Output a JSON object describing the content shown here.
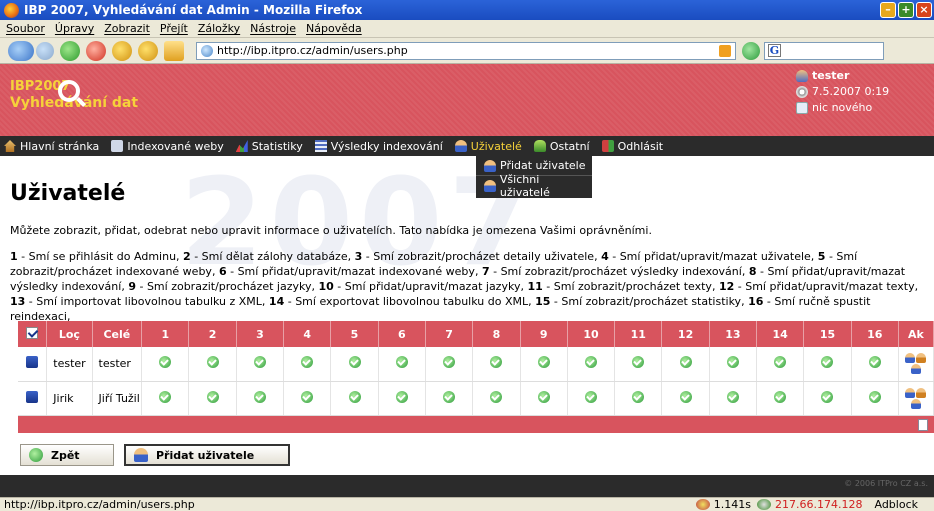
{
  "window": {
    "title": "IBP 2007, Vyhledávání dat Admin - Mozilla Firefox"
  },
  "menu": [
    "Soubor",
    "Úpravy",
    "Zobrazit",
    "Přejít",
    "Záložky",
    "Nástroje",
    "Nápověda"
  ],
  "address_bar": {
    "url": "http://ibp.itpro.cz/admin/users.php",
    "search_value": ""
  },
  "site": {
    "logo_line1": "IBP2007",
    "logo_line2": "Vyhledávání dat",
    "user": {
      "name": "tester",
      "datetime": "7.5.2007 0:19",
      "news": "nic nového"
    }
  },
  "nav": {
    "items": [
      {
        "label": "Hlavní stránka",
        "icon": "home-icon"
      },
      {
        "label": "Indexované weby",
        "icon": "web-icon"
      },
      {
        "label": "Statistiky",
        "icon": "stats-icon"
      },
      {
        "label": "Výsledky indexování",
        "icon": "results-icon"
      },
      {
        "label": "Uživatelé",
        "icon": "users-icon"
      },
      {
        "label": "Ostatní",
        "icon": "other-icon"
      },
      {
        "label": "Odhlásit",
        "icon": "logout-icon"
      }
    ],
    "dropdown": [
      "Přidat uživatele",
      "Všichni uživatelé"
    ]
  },
  "page": {
    "title": "Uživatelé",
    "intro": "Můžete zobrazit, přidat, odebrat nebo upravit informace o uživatelích. Tato nabídka je omezena Vašimi oprávněními.",
    "permissions": [
      {
        "num": "1",
        "text": "Smí se přihlásit do Adminu"
      },
      {
        "num": "2",
        "text": "Smí dělat zálohy databáze"
      },
      {
        "num": "3",
        "text": "Smí zobrazit/procházet detaily uživatele"
      },
      {
        "num": "4",
        "text": "Smí přidat/upravit/mazat uživatele"
      },
      {
        "num": "5",
        "text": "Smí zobrazit/procházet indexované weby"
      },
      {
        "num": "6",
        "text": "Smí přidat/upravit/mazat indexované weby"
      },
      {
        "num": "7",
        "text": "Smí zobrazit/procházet výsledky indexování"
      },
      {
        "num": "8",
        "text": "Smí přidat/upravit/mazat výsledky indexování"
      },
      {
        "num": "9",
        "text": "Smí zobrazit/procházet jazyky"
      },
      {
        "num": "10",
        "text": "Smí přidat/upravit/mazat jazyky"
      },
      {
        "num": "11",
        "text": "Smí zobrazit/procházet texty"
      },
      {
        "num": "12",
        "text": "Smí přidat/upravit/mazat texty"
      },
      {
        "num": "13",
        "text": "Smí importovat libovolnou tabulku z XML"
      },
      {
        "num": "14",
        "text": "Smí exportovat libovolnou tabulku do XML"
      },
      {
        "num": "15",
        "text": "Smí zobrazit/procházet statistiky"
      },
      {
        "num": "16",
        "text": "Smí ručně spustit reindexaci"
      }
    ]
  },
  "table": {
    "headers": [
      "",
      "Loç",
      "Celé",
      "1",
      "2",
      "3",
      "4",
      "5",
      "6",
      "7",
      "8",
      "9",
      "10",
      "11",
      "12",
      "13",
      "14",
      "15",
      "16",
      "Ak"
    ],
    "rows": [
      {
        "login": "tester",
        "name": "tester",
        "perms": [
          true,
          true,
          true,
          true,
          true,
          true,
          true,
          true,
          true,
          true,
          true,
          true,
          true,
          true,
          true,
          true
        ]
      },
      {
        "login": "Jirik",
        "name": "Jiří Tužil",
        "perms": [
          true,
          true,
          true,
          true,
          true,
          true,
          true,
          true,
          true,
          true,
          true,
          true,
          true,
          true,
          true,
          true
        ]
      }
    ]
  },
  "buttons": {
    "back": "Zpět",
    "add_user": "Přidat uživatele"
  },
  "footer": {
    "copyright": "© 2006 ITPro CZ a.s."
  },
  "status": {
    "url": "http://ibp.itpro.cz/admin/users.php",
    "time": "1.141s",
    "ip": "217.66.174.128",
    "adblock": "Adblock"
  },
  "colors": {
    "accent": "#d8545e",
    "nav_bg": "#2b2b2b",
    "active_nav": "#f6d23a"
  }
}
